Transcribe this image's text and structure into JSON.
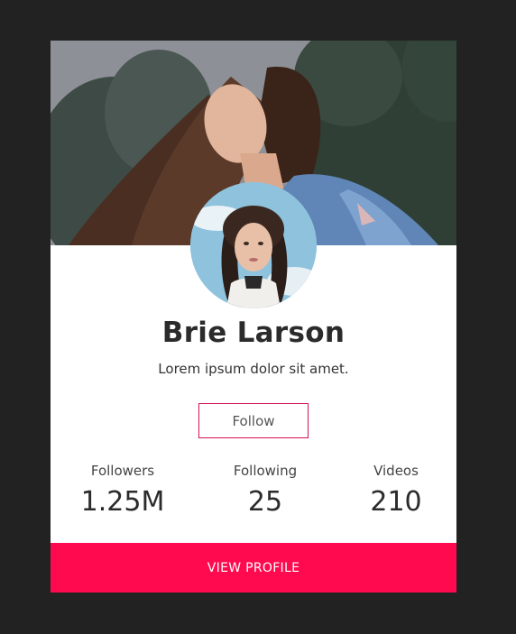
{
  "profile": {
    "name": "Brie Larson",
    "bio": "Lorem ipsum dolor sit amet.",
    "follow_label": "Follow",
    "view_profile_label": "VIEW PROFILE"
  },
  "stats": [
    {
      "label": "Followers",
      "value": "1.25M"
    },
    {
      "label": "Following",
      "value": "25"
    },
    {
      "label": "Videos",
      "value": "210"
    }
  ],
  "colors": {
    "background": "#222222",
    "card": "#ffffff",
    "accent": "#ff0a4f",
    "follow_border": "#d31250",
    "text_dark": "#2b2b2b"
  }
}
